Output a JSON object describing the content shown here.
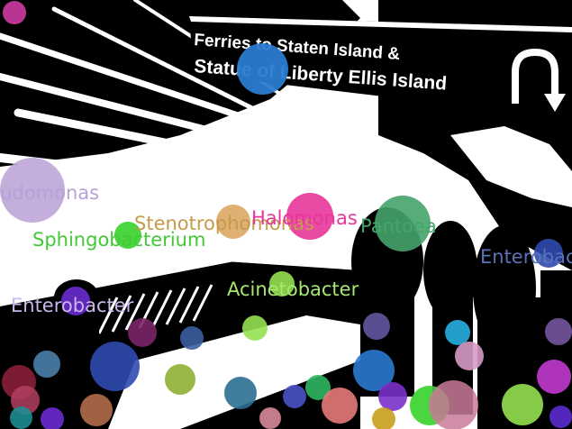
{
  "sign": {
    "line1": "Ferries to Staten Island &",
    "line2": "Statue of Liberty Ellis Island"
  },
  "labels": [
    {
      "text": "Pseudomonas",
      "color": "#b9a0d6"
    },
    {
      "text": "Stenotrophomonas",
      "color": "#c69a4e"
    },
    {
      "text": "Halomonas",
      "color": "#e8359a"
    },
    {
      "text": "Pantoea",
      "color": "#45a46b"
    },
    {
      "text": "Sphingobacterium",
      "color": "#43c937"
    },
    {
      "text": "Enterobacter",
      "color": "#5a73b8"
    },
    {
      "text": "Enterobacter",
      "color": "#c9b7ec"
    },
    {
      "text": "Acinetobacter",
      "color": "#a6e76f"
    }
  ],
  "bubble_colors": {
    "magenta": "#c4389a",
    "blue": "#2a7ad0",
    "lavender": "#b9a0d6",
    "tan": "#d8a35a",
    "pink": "#e8359a",
    "green": "#45a46b",
    "lime": "#36d22a",
    "navy": "#2f4ab0",
    "violet": "#6a2bd0",
    "lightgreen": "#94e14f",
    "plum": "#7a2566",
    "steel": "#3a5ea0",
    "olive": "#8eb032",
    "teal": "#2b6f92",
    "rose": "#e77a7a",
    "wine": "#8a1f3a",
    "sienna": "#b36b4a",
    "cyan": "#27aee0",
    "gold": "#c8a01e",
    "orchid": "#d79ac5"
  }
}
